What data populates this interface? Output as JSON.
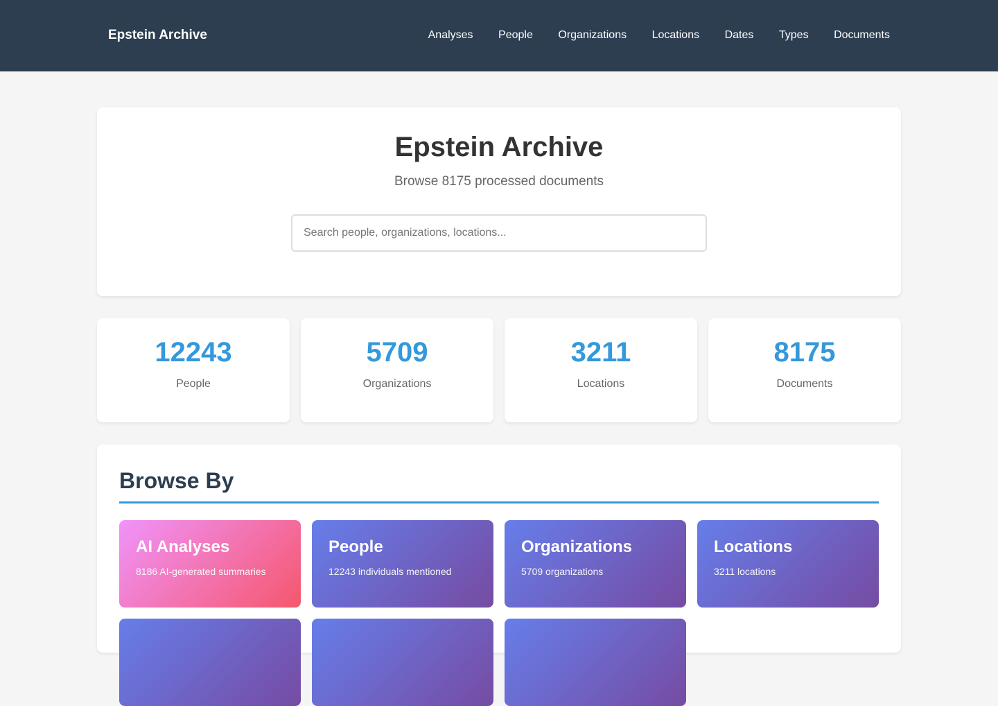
{
  "nav": {
    "brand": "Epstein Archive",
    "links": [
      "Analyses",
      "People",
      "Organizations",
      "Locations",
      "Dates",
      "Types",
      "Documents"
    ]
  },
  "hero": {
    "title": "Epstein Archive",
    "subtitle": "Browse 8175 processed documents",
    "search_placeholder": "Search people, organizations, locations..."
  },
  "stats": [
    {
      "value": "12243",
      "label": "People"
    },
    {
      "value": "5709",
      "label": "Organizations"
    },
    {
      "value": "3211",
      "label": "Locations"
    },
    {
      "value": "8175",
      "label": "Documents"
    }
  ],
  "browse": {
    "heading": "Browse By",
    "tiles": [
      {
        "title": "AI Analyses",
        "desc": "8186 AI-generated summaries"
      },
      {
        "title": "People",
        "desc": "12243 individuals mentioned"
      },
      {
        "title": "Organizations",
        "desc": "5709 organizations"
      },
      {
        "title": "Locations",
        "desc": "3211 locations"
      }
    ]
  },
  "colors": {
    "nav_bg": "#2c3e50",
    "accent": "#3498db",
    "tile_gradient": [
      "#667eea",
      "#764ba2"
    ],
    "tile_ai_gradient": [
      "#f093fb",
      "#f5576c"
    ]
  }
}
